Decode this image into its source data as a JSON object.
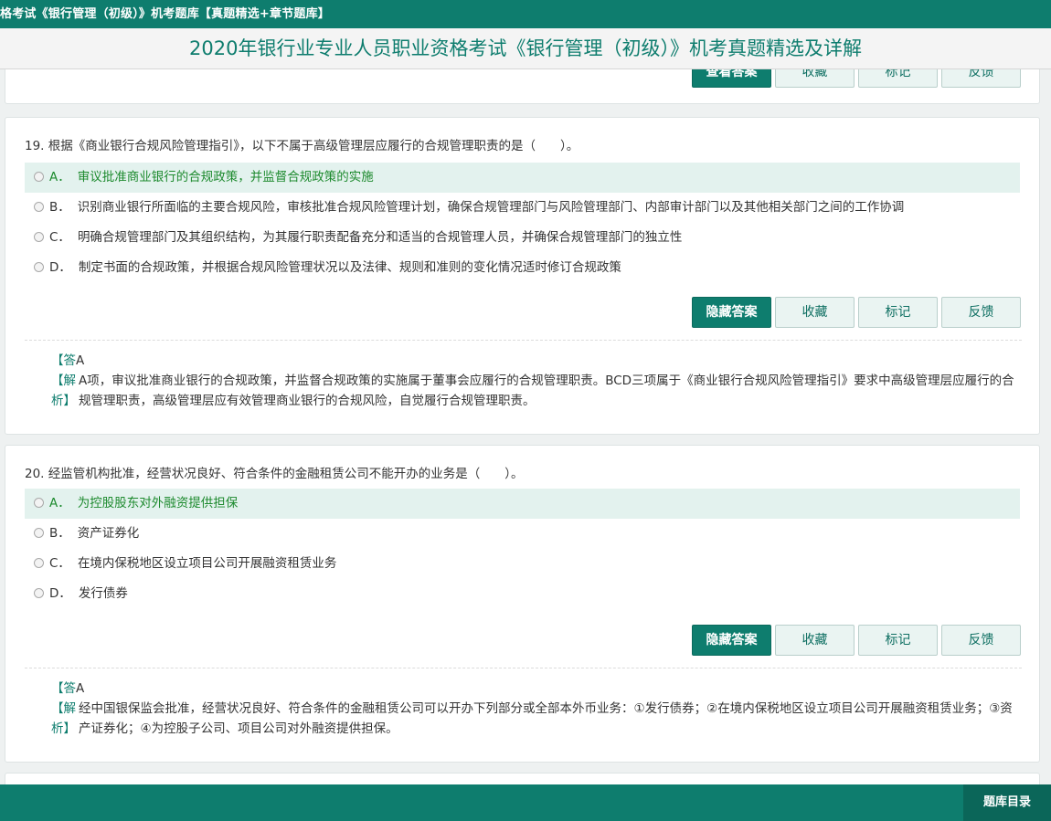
{
  "topbar": {
    "text": "格考试《银行管理（初级）》机考题库【真题精选+章节题库】"
  },
  "header": {
    "title": "2020年银行业专业人员职业资格考试《银行管理（初级）》机考真题精选及详解"
  },
  "buttons": {
    "view": "查看答案",
    "hide": "隐藏答案",
    "fav": "收藏",
    "mark": "标记",
    "feedback": "反馈"
  },
  "questions": [
    {
      "title": "19. 根据《商业银行合规风险管理指引》，以下不属于高级管理层应履行的合规管理职责的是（　　）。",
      "options": [
        {
          "letter": "A．",
          "text": "审议批准商业银行的合规政策，并监督合规政策的实施"
        },
        {
          "letter": "B．",
          "text": "识别商业银行所面临的主要合规风险，审核批准合规风险管理计划，确保合规管理部门与风险管理部门、内部审计部门以及其他相关部门之间的工作协调"
        },
        {
          "letter": "C．",
          "text": "明确合规管理部门及其组织结构，为其履行职责配备充分和适当的合规管理人员，并确保合规管理部门的独立性"
        },
        {
          "letter": "D．",
          "text": "制定书面的合规政策，并根据合规风险管理状况以及法律、规则和准则的变化情况适时修订合规政策"
        }
      ],
      "answer_label": "【答",
      "answer": "A",
      "explain_label_1": "【解",
      "explain_label_2": "析】",
      "explanation": "A项，审议批准商业银行的合规政策，并监督合规政策的实施属于董事会应履行的合规管理职责。BCD三项属于《商业银行合规风险管理指引》要求中高级管理层应履行的合规管理职责，高级管理层应有效管理商业银行的合规风险，自觉履行合规管理职责。"
    },
    {
      "title": "20. 经监管机构批准，经营状况良好、符合条件的金融租赁公司不能开办的业务是（　　）。",
      "options": [
        {
          "letter": "A．",
          "text": "为控股股东对外融资提供担保"
        },
        {
          "letter": "B．",
          "text": "资产证券化"
        },
        {
          "letter": "C．",
          "text": "在境内保税地区设立项目公司开展融资租赁业务"
        },
        {
          "letter": "D．",
          "text": "发行债券"
        }
      ],
      "answer_label": "【答",
      "answer": "A",
      "explain_label_1": "【解",
      "explain_label_2": "析】",
      "explanation": "经中国银保监会批准，经营状况良好、符合条件的金融租赁公司可以开办下列部分或全部本外币业务：①发行债券；②在境内保税地区设立项目公司开展融资租赁业务；③资产证券化；④为控股子公司、项目公司对外融资提供担保。"
    }
  ],
  "footer": {
    "catalog": "题库目录"
  },
  "colors": {
    "accent": "#0e7d6e",
    "correct": "#1d8a2e",
    "highlight": "#e3f2ee"
  }
}
